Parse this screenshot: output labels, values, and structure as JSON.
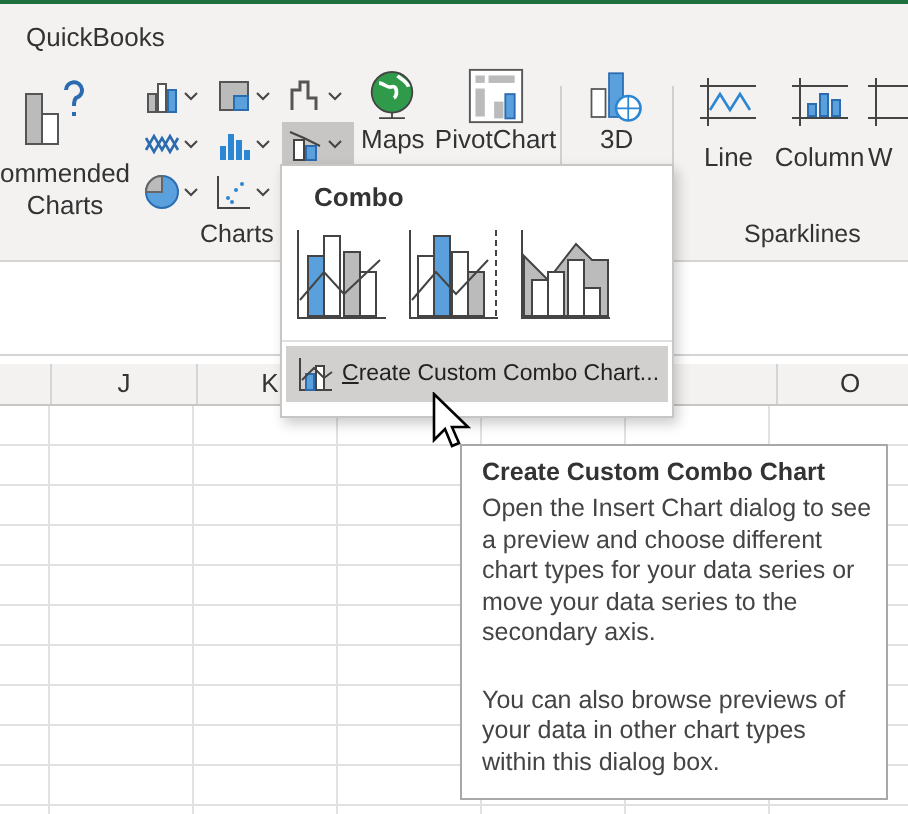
{
  "tab": {
    "label": "QuickBooks"
  },
  "ribbon": {
    "recommended": {
      "lines": [
        "ommended",
        "Charts"
      ]
    },
    "combo_button": {
      "pressed": true
    },
    "large_buttons": [
      {
        "label": "Maps"
      },
      {
        "label": "PivotChart"
      },
      {
        "label": "3D"
      }
    ],
    "sparklines": [
      {
        "label": "Line"
      },
      {
        "label": "Column"
      },
      {
        "label": "W"
      }
    ],
    "group_labels": [
      "Charts",
      "Sparklines"
    ]
  },
  "columns": [
    {
      "label": "J"
    },
    {
      "label": "K"
    },
    {
      "label": "O"
    }
  ],
  "combo_menu": {
    "title": "Combo",
    "item": {
      "label": "Create Custom Combo Chart...",
      "highlighted": true
    }
  },
  "tooltip": {
    "title": "Create Custom Combo Chart",
    "paragraphs": [
      "Open the Insert Chart dialog to see a preview and choose different chart types for your data series or move your data series to the secondary axis.",
      "You can also browse previews of your data in other chart types within this dialog box."
    ]
  }
}
